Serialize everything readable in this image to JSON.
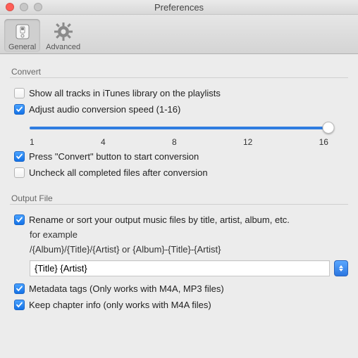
{
  "window": {
    "title": "Preferences"
  },
  "toolbar": {
    "general": "General",
    "advanced": "Advanced"
  },
  "groups": {
    "convert": "Convert",
    "output": "Output File"
  },
  "convert": {
    "show_all": {
      "label": "Show all tracks in iTunes library on the playlists",
      "checked": false
    },
    "adjust_speed": {
      "label": "Adjust audio conversion speed (1-16)",
      "checked": true
    },
    "speed": {
      "min": 1,
      "max": 16,
      "value": 16,
      "ticks": [
        "1",
        "4",
        "8",
        "12",
        "16"
      ]
    },
    "press_convert": {
      "label": "Press \"Convert\" button to start conversion",
      "checked": true
    },
    "uncheck_completed": {
      "label": "Uncheck all completed files after conversion",
      "checked": false
    }
  },
  "output": {
    "rename": {
      "label": "Rename or sort your output music files by title, artist, album, etc.",
      "checked": true,
      "example_prefix": "for example",
      "example": "/{Album}/{Title}/{Artist} or {Album}-{Title}-{Artist}",
      "value": "{Title} {Artist}"
    },
    "metadata": {
      "label": "Metadata tags (Only works with M4A, MP3 files)",
      "checked": true
    },
    "chapter": {
      "label": "Keep chapter info (only works with  M4A files)",
      "checked": true
    }
  }
}
